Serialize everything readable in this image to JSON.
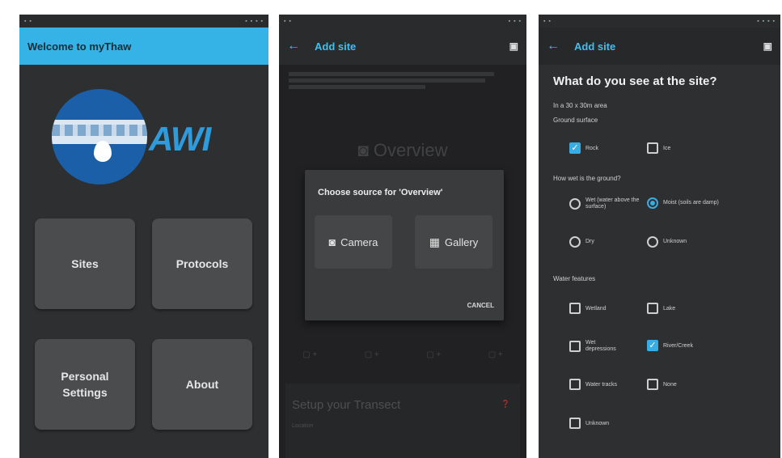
{
  "panel1": {
    "title": "Welcome to myThaw",
    "logo_text": "AWI",
    "tiles": [
      {
        "label": "Sites"
      },
      {
        "label": "Protocols"
      },
      {
        "label": "Personal Settings"
      },
      {
        "label": "About"
      }
    ]
  },
  "panel2": {
    "title": "Add site",
    "back_icon": "arrow-left-icon",
    "save_icon": "save-icon",
    "overview_label": "Overview",
    "dialog": {
      "title": "Choose source for 'Overview'",
      "camera_label": "Camera",
      "gallery_label": "Gallery",
      "cancel_label": "CANCEL"
    },
    "transect_title": "Setup your Transect",
    "transect_subtitle": "Location"
  },
  "panel3": {
    "title": "Add site",
    "question": "What do you see at the site?",
    "area_label": "In a 30 x 30m area",
    "ground_surface_label": "Ground surface",
    "ground_surface": [
      {
        "label": "Rock",
        "checked": true
      },
      {
        "label": "Ice",
        "checked": false
      }
    ],
    "wetness_label": "How wet is the ground?",
    "wetness": [
      {
        "label": "Wet (water above the surface)",
        "checked": false
      },
      {
        "label": "Moist (soils are damp)",
        "checked": true
      },
      {
        "label": "Dry",
        "checked": false
      },
      {
        "label": "Unknown",
        "checked": false
      }
    ],
    "water_label": "Water features",
    "water_features": [
      {
        "label": "Wetland",
        "checked": false
      },
      {
        "label": "Lake",
        "checked": false
      },
      {
        "label": "Wet depressions",
        "checked": false
      },
      {
        "label": "River/Creek",
        "checked": true
      },
      {
        "label": "Water tracks",
        "checked": false
      },
      {
        "label": "None",
        "checked": false
      },
      {
        "label": "Unknown",
        "checked": false
      }
    ]
  },
  "colors": {
    "accent": "#35b3e6",
    "background": "#2e2f31",
    "tile": "#4b4c4e"
  }
}
